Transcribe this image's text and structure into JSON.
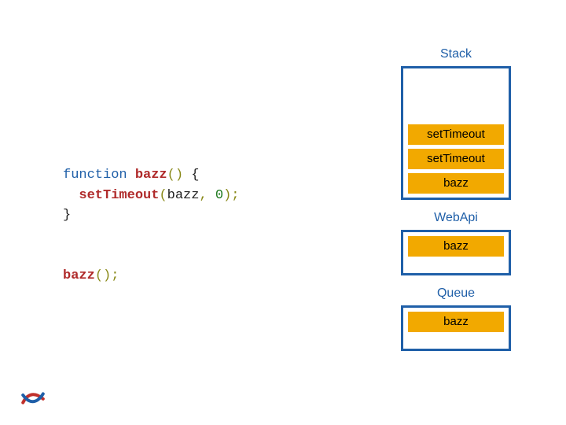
{
  "code": {
    "keyword_function": "function",
    "fn_name": "bazz",
    "open_paren": "(",
    "close_paren": ")",
    "open_brace": " {",
    "indent": "  ",
    "settimeout": "setTimeout",
    "arg_fn": "bazz",
    "comma_sp": ", ",
    "arg_delay": "0",
    "close_call": ");",
    "close_brace": "}",
    "invoke_fn": "bazz",
    "invoke_tail": "();"
  },
  "panels": {
    "stack": {
      "title": "Stack",
      "items": [
        "setTimeout",
        "setTimeout",
        "bazz"
      ]
    },
    "webapi": {
      "title": "WebApi",
      "items": [
        "bazz"
      ]
    },
    "queue": {
      "title": "Queue",
      "items": [
        "bazz"
      ]
    }
  }
}
